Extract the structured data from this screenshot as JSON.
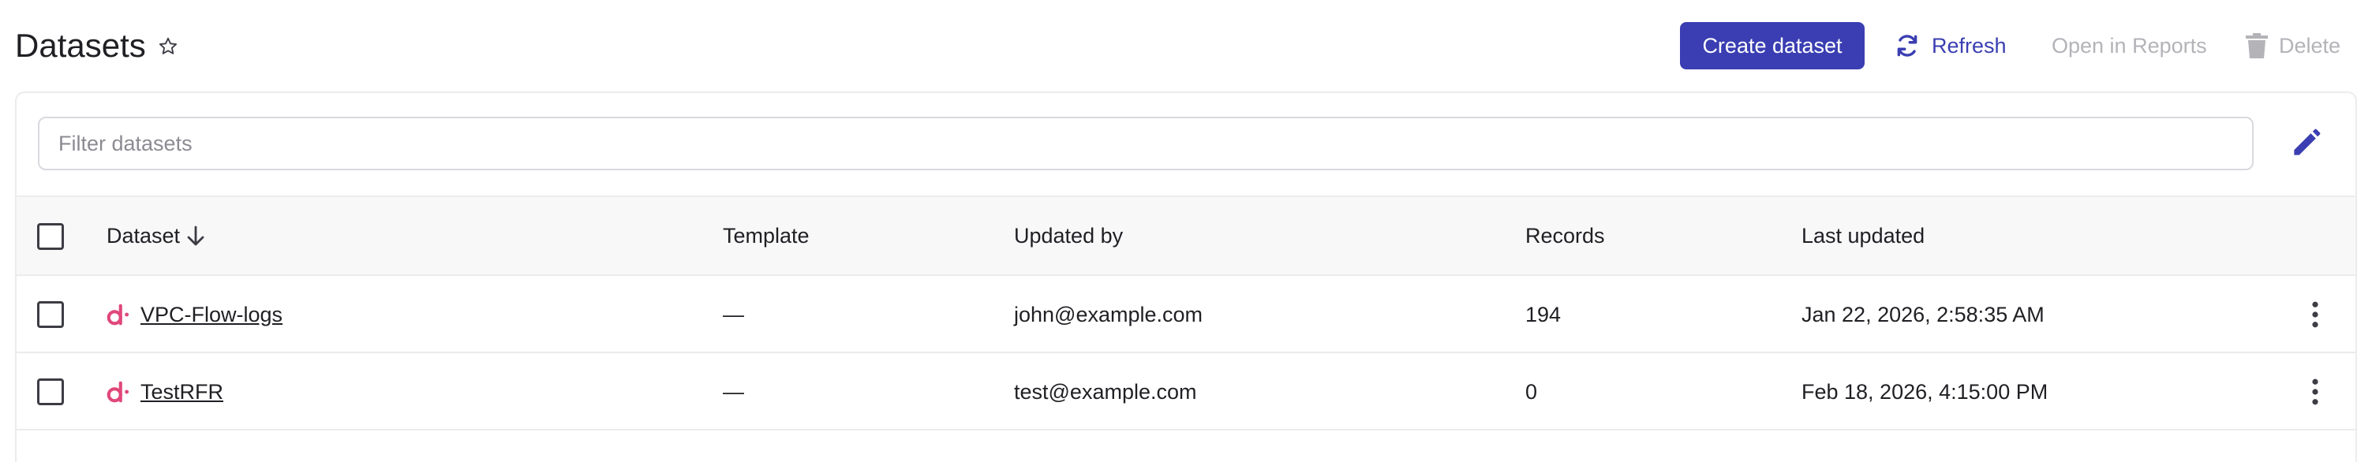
{
  "page": {
    "title": "Datasets",
    "favorite_icon": "star-outline-icon"
  },
  "toolbar": {
    "create_label": "Create dataset",
    "refresh_label": "Refresh",
    "open_reports_label": "Open in Reports",
    "delete_label": "Delete"
  },
  "filter": {
    "placeholder": "Filter datasets",
    "value": ""
  },
  "table": {
    "columns": {
      "dataset": "Dataset",
      "template": "Template",
      "updated_by": "Updated by",
      "records": "Records",
      "last_updated": "Last updated"
    },
    "rows": [
      {
        "name": "VPC-Flow-logs",
        "template": "—",
        "updated_by": "john@example.com",
        "records": "194",
        "last_updated": "Jan 22, 2026, 2:58:35 AM"
      },
      {
        "name": "TestRFR",
        "template": "—",
        "updated_by": "test@example.com",
        "records": "0",
        "last_updated": "Feb 18, 2026, 4:15:00 PM"
      }
    ]
  },
  "colors": {
    "accent": "#3a3eb2",
    "disabled_text": "#b3b3b8",
    "dataset_icon": "#e0487a"
  }
}
